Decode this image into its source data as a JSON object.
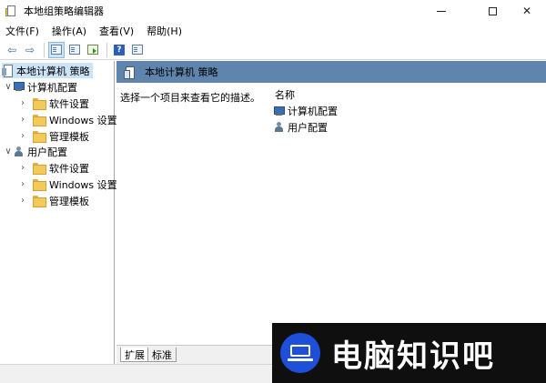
{
  "window": {
    "title": "本地组策略编辑器",
    "close_glyph": "✕"
  },
  "menu": [
    "文件(F)",
    "操作(A)",
    "查看(V)",
    "帮助(H)"
  ],
  "toolbar": {
    "back_glyph": "⇦",
    "forward_glyph": "⇨",
    "help_glyph": "?"
  },
  "tree": {
    "root": "本地计算机 策略",
    "computer": {
      "label": "计算机配置",
      "children": [
        "软件设置",
        "Windows 设置",
        "管理模板"
      ]
    },
    "user": {
      "label": "用户配置",
      "children": [
        "软件设置",
        "Windows 设置",
        "管理模板"
      ]
    },
    "expanded_glyph": "∨",
    "collapsed_glyph": "›"
  },
  "content": {
    "header_title": "本地计算机 策略",
    "description": "选择一个项目来查看它的描述。",
    "column_name": "名称",
    "items": [
      "计算机配置",
      "用户配置"
    ]
  },
  "tabs": [
    "扩展",
    "标准"
  ],
  "watermark": {
    "text": "电脑知识吧"
  }
}
